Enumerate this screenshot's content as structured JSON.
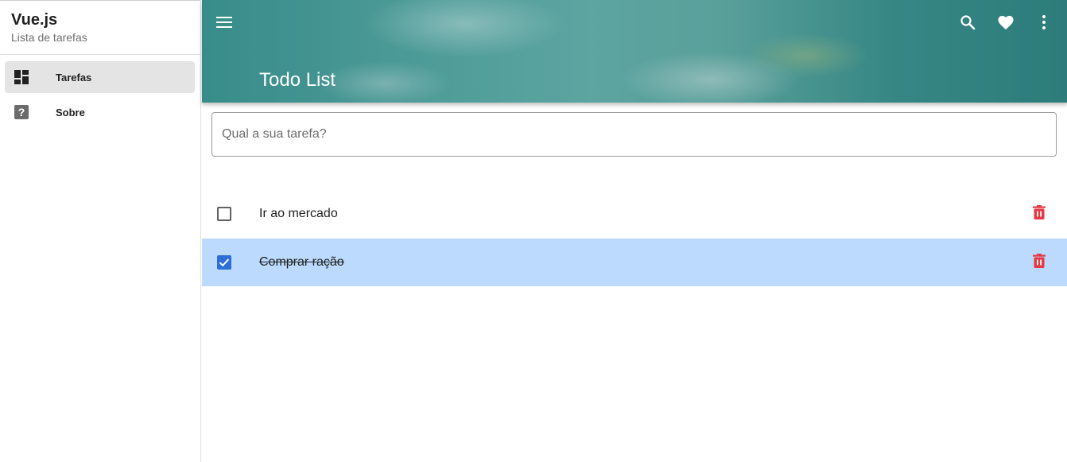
{
  "sidebar": {
    "title": "Vue.js",
    "subtitle": "Lista de tarefas",
    "items": [
      {
        "label": "Tarefas",
        "icon": "dashboard-icon",
        "active": true
      },
      {
        "label": "Sobre",
        "icon": "help-icon",
        "active": false
      }
    ]
  },
  "header": {
    "title": "Todo List",
    "icons": [
      "menu-icon",
      "search-icon",
      "heart-icon",
      "more-vert-icon"
    ]
  },
  "input": {
    "placeholder": "Qual a sua tarefa?",
    "value": ""
  },
  "tasks": [
    {
      "label": "Ir ao mercado",
      "done": false
    },
    {
      "label": "Comprar ração",
      "done": true
    }
  ],
  "colors": {
    "accent": "#2f6ed9",
    "done_row": "#bbdafd",
    "delete": "#e53945",
    "header_teal": "#3d8f8c"
  }
}
